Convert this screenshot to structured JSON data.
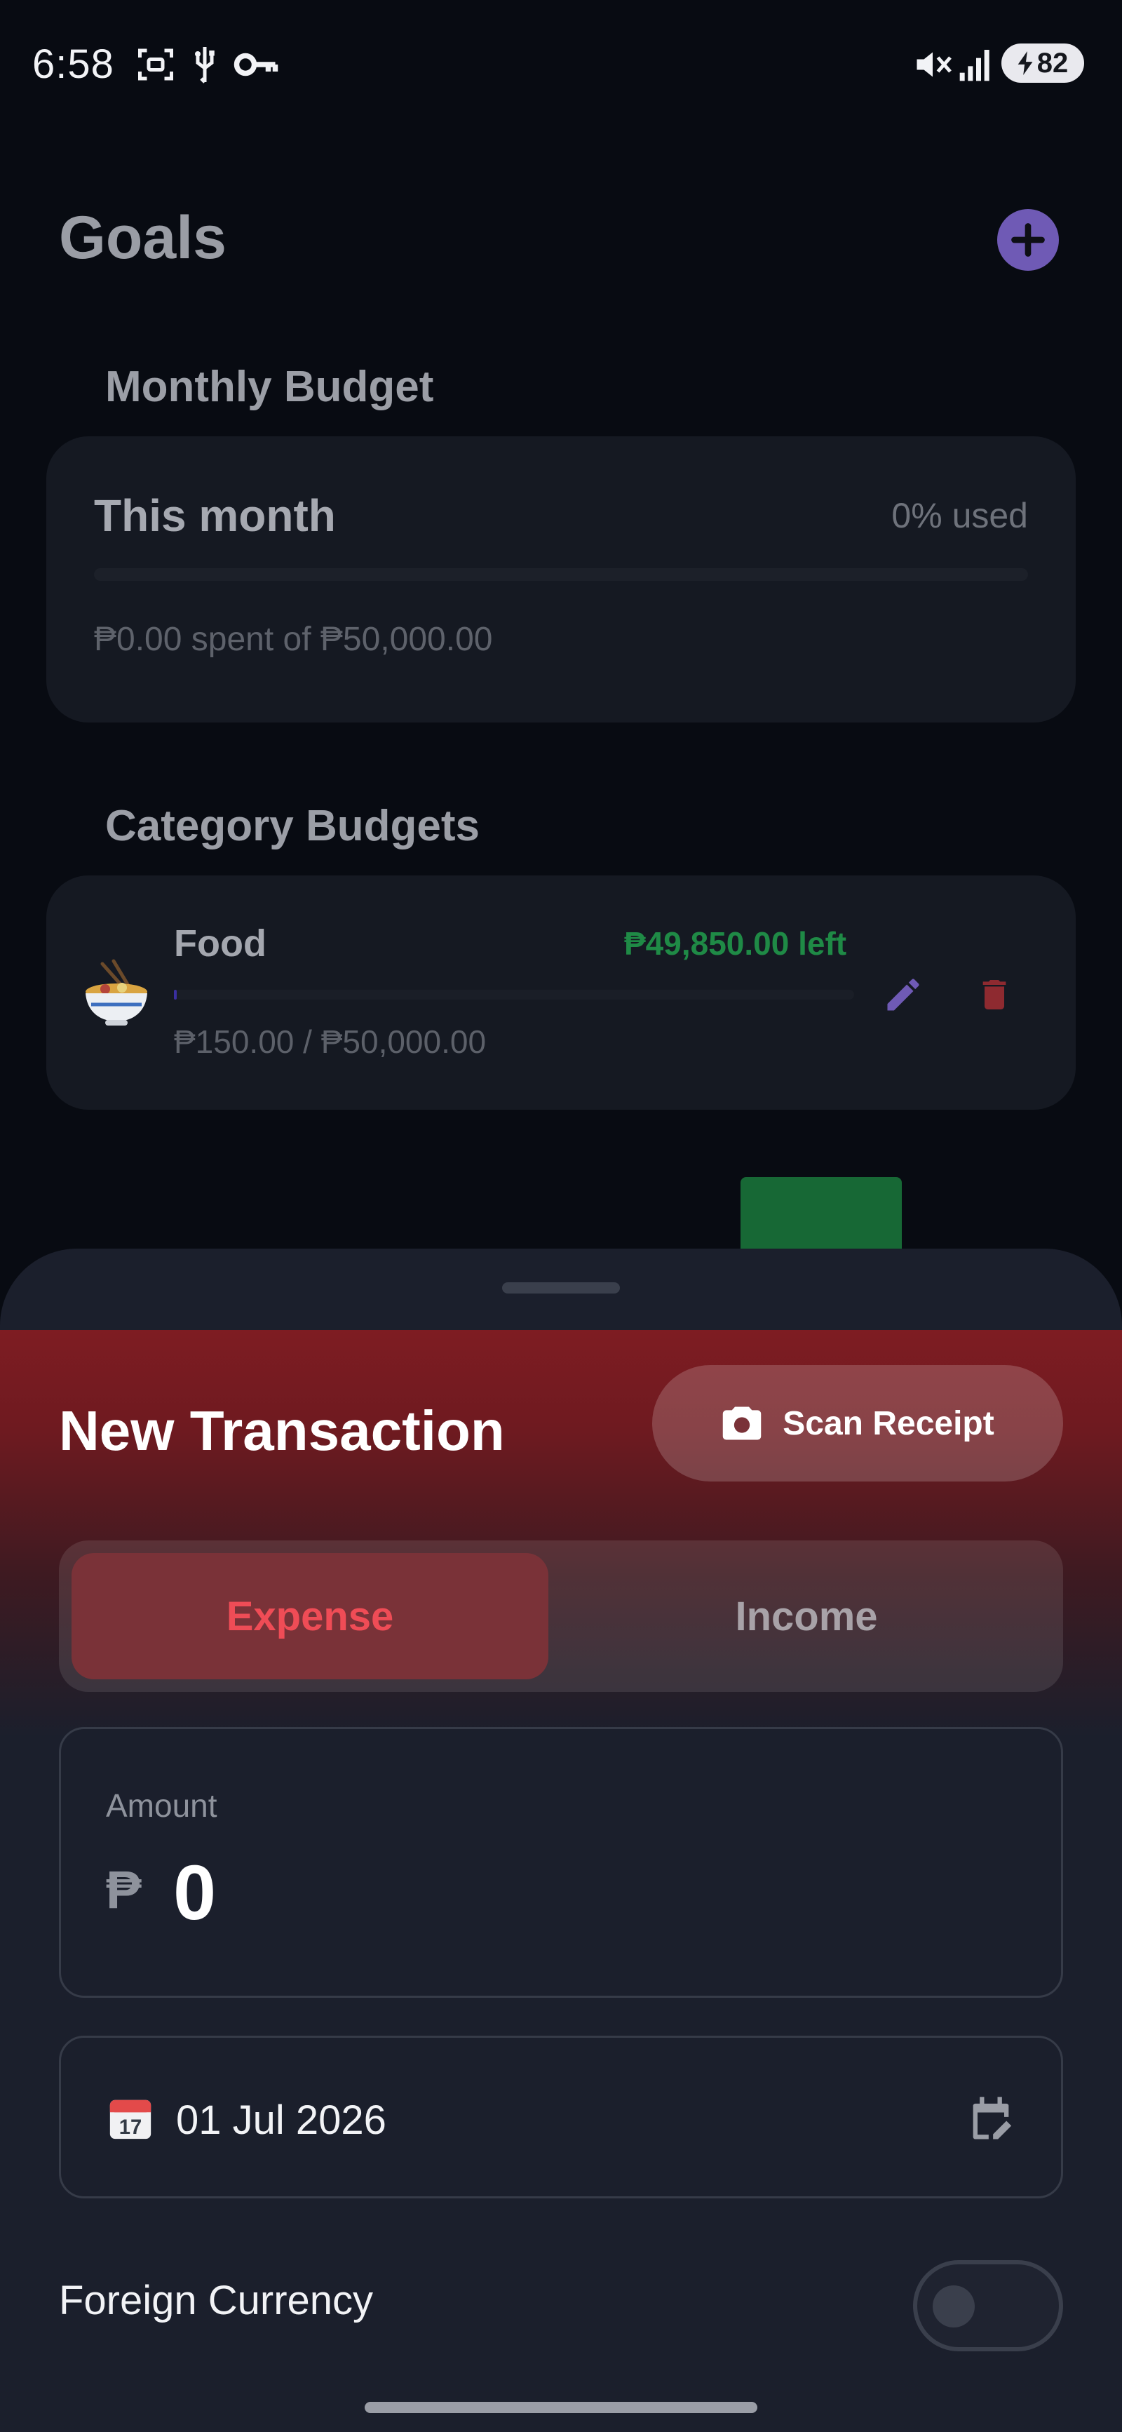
{
  "status_bar": {
    "time": "6:58",
    "battery": "82"
  },
  "goals": {
    "title": "Goals",
    "monthly_budget": {
      "section_label": "Monthly Budget",
      "card_title": "This month",
      "used": "0% used",
      "spent": "₱0.00 spent of ₱50,000.00"
    },
    "category_budgets": {
      "section_label": "Category Budgets",
      "items": [
        {
          "emoji": "🍜",
          "name": "Food",
          "left": "₱49,850.00 left",
          "amount": "₱150.00 / ₱50,000.00",
          "progress": 0.003
        }
      ]
    }
  },
  "sheet": {
    "title": "New Transaction",
    "scan_label": "Scan Receipt",
    "tabs": {
      "expense": "Expense",
      "income": "Income",
      "selected": "Expense"
    },
    "amount": {
      "label": "Amount",
      "currency": "₱",
      "value": "0"
    },
    "date": {
      "value": "01 Jul 2026"
    },
    "foreign_currency": {
      "label": "Foreign Currency",
      "enabled": false
    }
  },
  "colors": {
    "accent": "#6f5ab5",
    "expense": "#ef4c56",
    "success": "#1f8a46",
    "danger": "#8e2a30"
  }
}
